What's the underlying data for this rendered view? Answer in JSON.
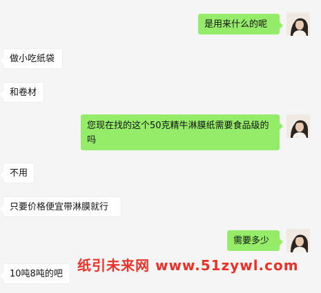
{
  "messages": [
    {
      "side": "out",
      "text": "是用来什么的呢"
    },
    {
      "side": "in",
      "text": "做小吃纸袋"
    },
    {
      "side": "in",
      "text": "和卷材"
    },
    {
      "side": "out",
      "text": "您现在找的这个50克精牛淋膜纸需要食品级的吗"
    },
    {
      "side": "in",
      "text": "不用"
    },
    {
      "side": "in",
      "text": "只要价格便宜带淋膜就行"
    },
    {
      "side": "out",
      "text": "需要多少"
    },
    {
      "side": "in",
      "text": "10吨8吨的吧"
    }
  ],
  "watermark": {
    "text": "纸引未来网 www.51zywl.com",
    "color": "#e8322a"
  },
  "colors": {
    "outgoing_bubble": "#95ec69",
    "incoming_bubble": "#ffffff",
    "background": "#f5f5f5"
  },
  "icons": {
    "avatar": "user-avatar-photo"
  }
}
